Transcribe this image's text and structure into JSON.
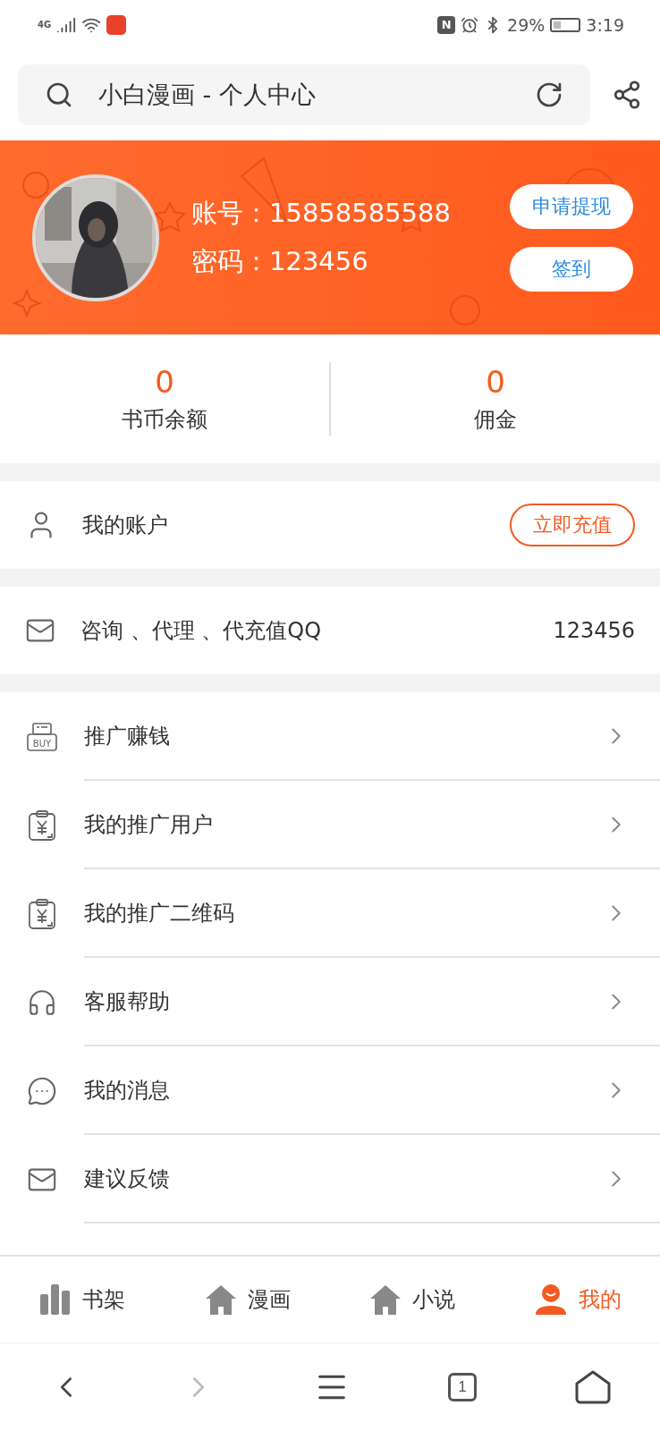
{
  "status_bar": {
    "network": "4G",
    "nfc": "N",
    "battery": "29%",
    "time": "3:19"
  },
  "address_bar": {
    "title": "小白漫画 - 个人中心"
  },
  "profile": {
    "account_label": "账号：",
    "account": "15858585588",
    "password_label": "密码：",
    "password": "123456",
    "buttons": [
      "申请提现",
      "签到"
    ]
  },
  "stats": [
    {
      "value": "0",
      "label": "书币余额"
    },
    {
      "value": "0",
      "label": "佣金"
    }
  ],
  "account_row": {
    "label": "我的账户",
    "button": "立即充值"
  },
  "contact_row": {
    "label": "咨询 、代理 、代充值QQ",
    "value": "123456"
  },
  "menu": [
    {
      "kind": "buy",
      "label": "推广赚钱",
      "icon_label": "BUY"
    },
    {
      "kind": "yen",
      "label": "我的推广用户"
    },
    {
      "kind": "yen",
      "label": "我的推广二维码"
    },
    {
      "kind": "headset",
      "label": "客服帮助"
    },
    {
      "kind": "chat",
      "label": "我的消息"
    },
    {
      "kind": "mail",
      "label": "建议反馈"
    }
  ],
  "tabs": [
    {
      "kind": "shelf",
      "label": "书架",
      "selected": false
    },
    {
      "kind": "house",
      "label": "漫画",
      "selected": false
    },
    {
      "kind": "house",
      "label": "小说",
      "selected": false
    },
    {
      "kind": "person",
      "label": "我的",
      "selected": true
    }
  ],
  "browser_bar": {
    "tab_count": "1"
  }
}
